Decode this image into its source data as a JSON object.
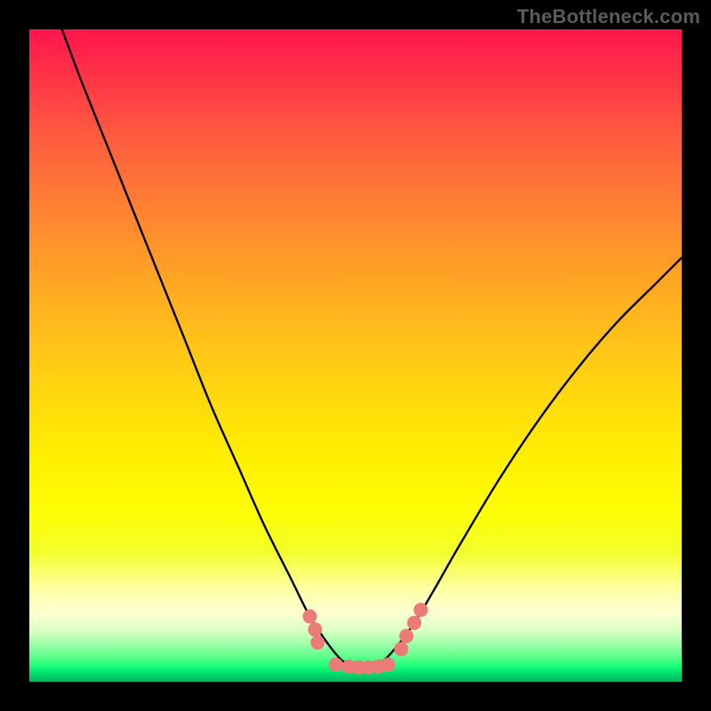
{
  "watermark": "TheBottleneck.com",
  "colors": {
    "frame": "#000000",
    "curve_stroke": "#000000",
    "marker_fill": "#ec7a77",
    "marker_stroke": "#ec7a77"
  },
  "chart_data": {
    "type": "line",
    "title": "",
    "xlabel": "",
    "ylabel": "",
    "xlim": [
      0,
      100
    ],
    "ylim": [
      0,
      100
    ],
    "note": "No axis ticks or numeric labels are rendered. X estimated as 0–100 scale across plot width; Y estimated as 0–100 with 0 at bottom (green band) and 100 at top (red band). Curve shape traced from image.",
    "series": [
      {
        "name": "bottleneck-curve",
        "x": [
          5,
          8,
          12,
          16,
          20,
          24,
          28,
          32,
          36,
          40,
          43,
          46,
          48,
          50,
          52,
          54,
          56,
          59,
          62,
          66,
          72,
          78,
          84,
          90,
          96,
          100
        ],
        "y": [
          100,
          92,
          82,
          72,
          62,
          52,
          42,
          33,
          24,
          16,
          10,
          5.5,
          3.2,
          2.2,
          2.2,
          3.0,
          5.0,
          9.0,
          14,
          21,
          31,
          40,
          48,
          55,
          61,
          65
        ]
      }
    ],
    "markers": {
      "name": "highlight-dots",
      "note": "Salmon dots near the valley region; approximate positions read from image on same 0–100 scale.",
      "points": [
        {
          "x": 43.0,
          "y": 10.0
        },
        {
          "x": 43.8,
          "y": 8.0
        },
        {
          "x": 44.2,
          "y": 6.0
        },
        {
          "x": 47.0,
          "y": 2.6
        },
        {
          "x": 49.0,
          "y": 2.3
        },
        {
          "x": 50.5,
          "y": 2.2
        },
        {
          "x": 52.0,
          "y": 2.2
        },
        {
          "x": 53.5,
          "y": 2.3
        },
        {
          "x": 55.0,
          "y": 2.6
        },
        {
          "x": 57.0,
          "y": 5.0
        },
        {
          "x": 57.8,
          "y": 7.0
        },
        {
          "x": 59.0,
          "y": 9.0
        },
        {
          "x": 60.0,
          "y": 11.0
        }
      ]
    }
  }
}
